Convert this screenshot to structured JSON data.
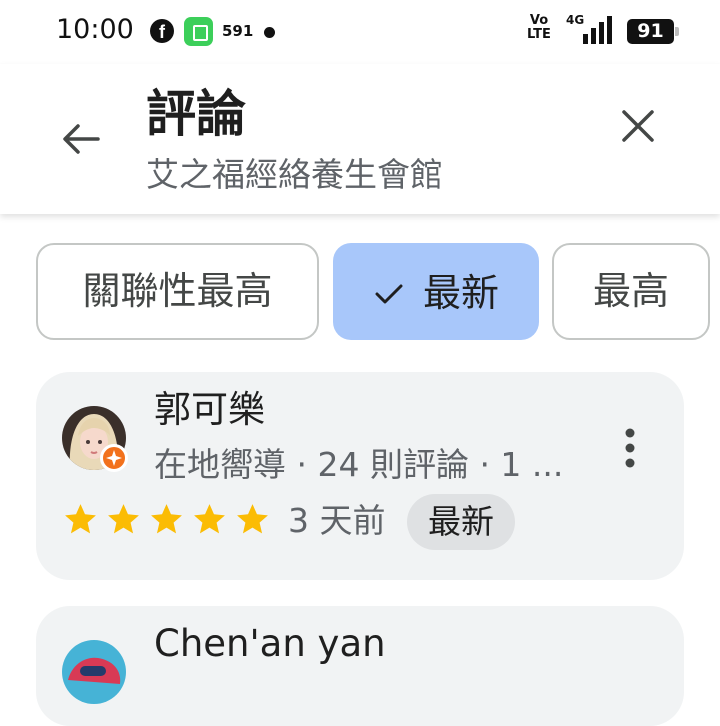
{
  "status_bar": {
    "time": "10:00",
    "fb_letter": "f",
    "app_badge": "591",
    "volte": "Vo LTE",
    "network": "4G",
    "battery": "91"
  },
  "header": {
    "title": "評論",
    "subtitle": "艾之福經絡養生會館",
    "back_icon": "arrow-back-icon",
    "close_icon": "close-icon"
  },
  "sort_chips": [
    {
      "label": "關聯性最高",
      "selected": false
    },
    {
      "label": "最新",
      "selected": true
    },
    {
      "label": "最高",
      "selected": false
    }
  ],
  "reviews": [
    {
      "name": "郭可樂",
      "meta": "在地嚮導 · 24 則評論 · 1 ...",
      "rating": 5,
      "time": "3 天前",
      "badge": "最新"
    },
    {
      "name": "Chen'an yan"
    }
  ],
  "colors": {
    "accent": "#a8c7fa",
    "star": "#fbbc04",
    "card_bg": "#f1f3f4",
    "guide_badge": "#f2711c"
  }
}
